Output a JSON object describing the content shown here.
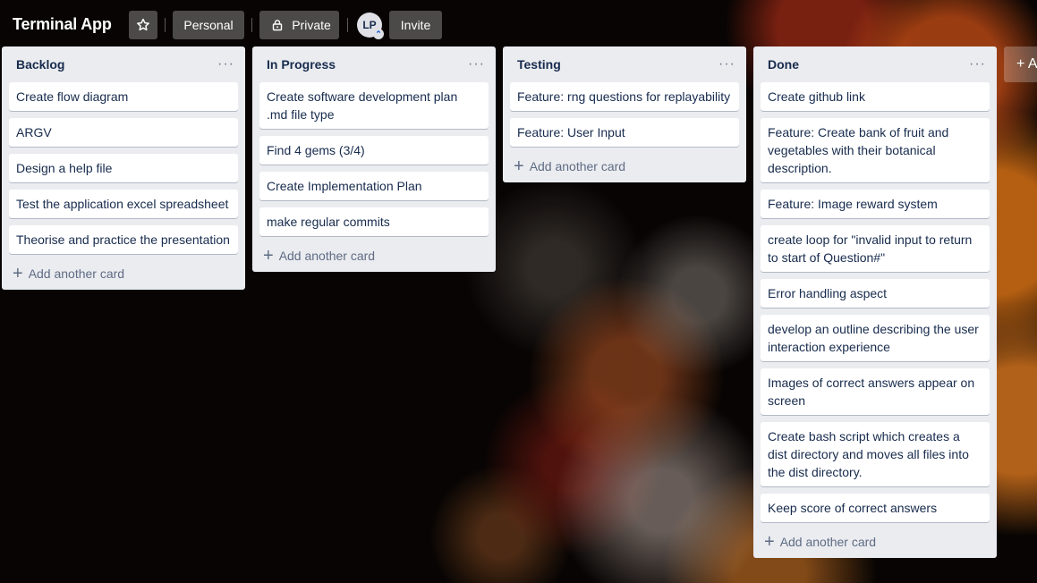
{
  "header": {
    "title": "Terminal App",
    "star_icon": "star-icon",
    "personal_label": "Personal",
    "private_label": "Private",
    "lock_icon": "lock-icon",
    "avatar_initials": "LP",
    "invite_label": "Invite"
  },
  "lists": [
    {
      "title": "Backlog",
      "cards": [
        "Create flow diagram",
        "ARGV",
        "Design a help file",
        "Test the application excel spreadsheet",
        "Theorise and practice the presentation"
      ],
      "add_label": "Add another card"
    },
    {
      "title": "In Progress",
      "cards": [
        "Create software development plan .md file type",
        "Find 4 gems (3/4)",
        "Create Implementation Plan",
        "make regular commits"
      ],
      "add_label": "Add another card"
    },
    {
      "title": "Testing",
      "cards": [
        "Feature: rng questions for replayability",
        "Feature: User Input"
      ],
      "add_label": "Add another card"
    },
    {
      "title": "Done",
      "cards": [
        "Create github link",
        "Feature: Create bank of fruit and vegetables with their botanical description.",
        "Feature: Image reward system",
        "create loop for \"invalid input to return to start of Question#\"",
        "Error handling aspect",
        "develop an outline describing the user interaction experience",
        "Images of correct answers appear on screen",
        "Create bash script which creates a dist directory and moves all files into the dist directory.",
        "Keep score of correct answers"
      ],
      "add_label": "Add another card"
    }
  ],
  "add_list_label": "+ A"
}
